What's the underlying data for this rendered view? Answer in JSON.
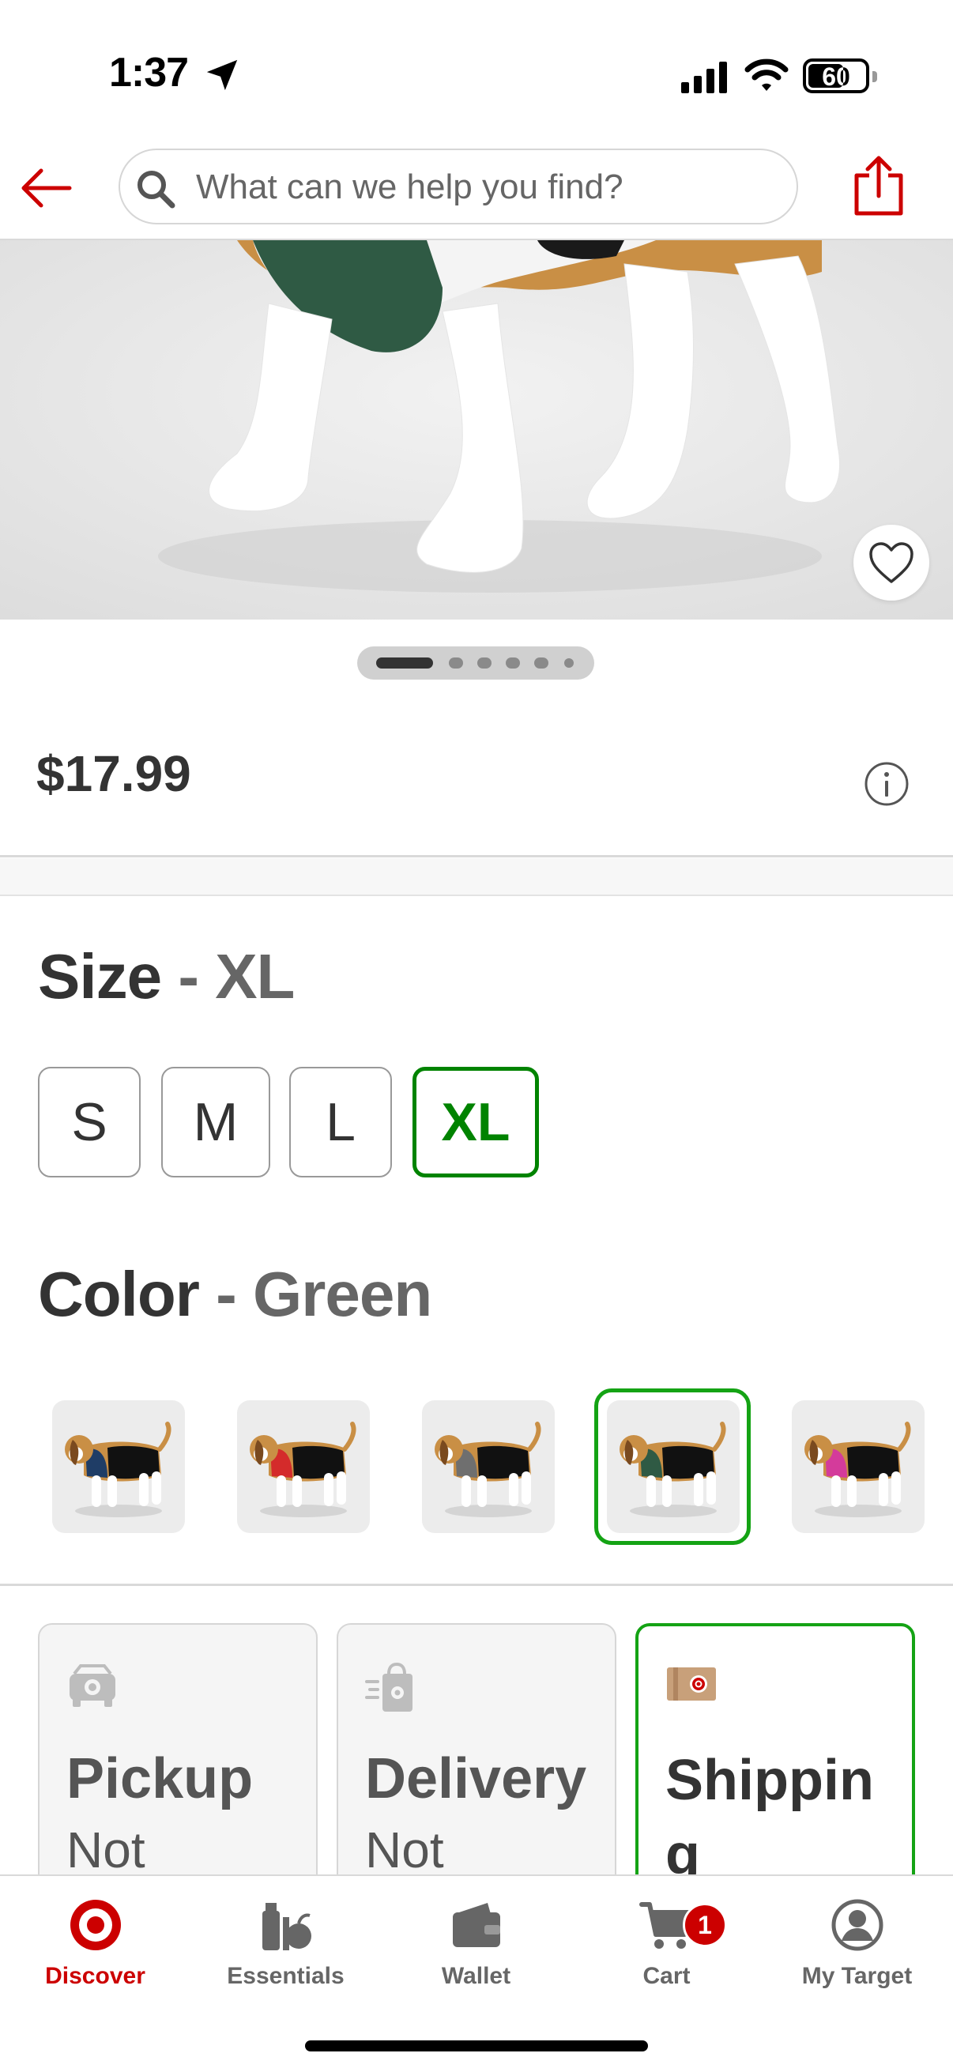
{
  "status_bar": {
    "time": "1:37",
    "battery": "60"
  },
  "header": {
    "search_placeholder": "What can we help you find?"
  },
  "carousel": {
    "total_images": 6,
    "current_index": 1
  },
  "product": {
    "price": "$17.99"
  },
  "size": {
    "heading": "Size",
    "separator": "-",
    "selected": "XL",
    "options": [
      "S",
      "M",
      "L",
      "XL"
    ]
  },
  "color": {
    "heading": "Color",
    "separator": "-",
    "selected": "Green",
    "swatch_count": 5,
    "swatch_harness_colors": [
      "#1f3d66",
      "#d42b2b",
      "#6f6f6f",
      "#2f5a44",
      "#d43b9b"
    ]
  },
  "fulfillment": [
    {
      "title": "Pickup",
      "status": "Not"
    },
    {
      "title": "Delivery",
      "status": "Not"
    },
    {
      "title": "Shippin g",
      "status": ""
    }
  ],
  "tabs": [
    {
      "label": "Discover"
    },
    {
      "label": "Essentials"
    },
    {
      "label": "Wallet"
    },
    {
      "label": "Cart"
    },
    {
      "label": "My Target"
    }
  ],
  "cart_badge": "1",
  "colors": {
    "brand_red": "#cc0000",
    "selected_green": "#008300"
  }
}
